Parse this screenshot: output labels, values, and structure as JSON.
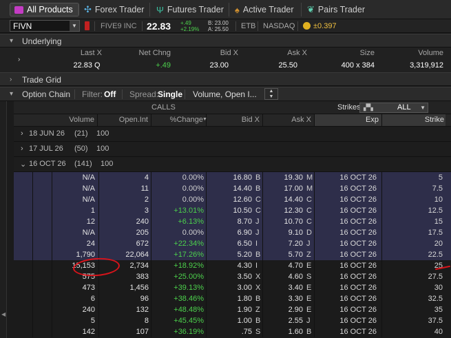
{
  "tabs": [
    {
      "label": "All Products",
      "icon": "all-products-icon",
      "active": true
    },
    {
      "label": "Forex Trader",
      "icon": "forex-icon",
      "active": false
    },
    {
      "label": "Futures Trader",
      "icon": "futures-icon",
      "active": false
    },
    {
      "label": "Active Trader",
      "icon": "active-trader-icon",
      "active": false
    },
    {
      "label": "Pairs Trader",
      "icon": "pairs-icon",
      "active": false
    }
  ],
  "quote": {
    "symbol": "FIVN",
    "name": "FIVE9 INC",
    "last": "22.83",
    "chg": "+.49",
    "pct": "+2.19%",
    "bid": "B: 23.00",
    "ask": "A: 25.50",
    "etb": "ETB",
    "exchange": "NASDAQ",
    "pl": "±0.397"
  },
  "underlying": {
    "title": "Underlying",
    "headers": [
      "Last X",
      "Net Chng",
      "Bid X",
      "Ask X",
      "Size",
      "Volume"
    ],
    "values": {
      "last": "22.83",
      "last_x": "Q",
      "net": "+.49",
      "bid": "23.00",
      "ask": "25.50",
      "size": "400 x 384",
      "volume": "3,319,912"
    }
  },
  "trade_grid": {
    "title": "Trade Grid"
  },
  "option_chain": {
    "title": "Option Chain",
    "filter_label": "Filter:",
    "filter_value": "Off",
    "spread_label": "Spread:",
    "spread_value": "Single",
    "layout_value": "Volume, Open I...",
    "calls_label": "CALLS",
    "strikes_label": "Strikes:",
    "strikes_value": "ALL",
    "columns": [
      "Volume",
      "Open.Int",
      "%Change",
      "Bid X",
      "Ask X",
      "Exp",
      "Strike"
    ],
    "groups": [
      {
        "date": "18 JUN 26",
        "days": "(21)",
        "mult": "100",
        "open": false
      },
      {
        "date": "17 JUL 26",
        "days": "(50)",
        "mult": "100",
        "open": false
      },
      {
        "date": "16 OCT 26",
        "days": "(141)",
        "mult": "100",
        "open": true
      }
    ],
    "rows": [
      {
        "vol": "N/A",
        "oi": "4",
        "pct": "0.00%",
        "bid": "16.80",
        "bx": "B",
        "ask": "19.30",
        "ax": "M",
        "exp": "16 OCT 26",
        "strike": "5",
        "itm": true
      },
      {
        "vol": "N/A",
        "oi": "11",
        "pct": "0.00%",
        "bid": "14.40",
        "bx": "B",
        "ask": "17.00",
        "ax": "M",
        "exp": "16 OCT 26",
        "strike": "7.5",
        "itm": true
      },
      {
        "vol": "N/A",
        "oi": "2",
        "pct": "0.00%",
        "bid": "12.60",
        "bx": "C",
        "ask": "14.40",
        "ax": "C",
        "exp": "16 OCT 26",
        "strike": "10",
        "itm": true
      },
      {
        "vol": "1",
        "oi": "3",
        "pct": "+13.01%",
        "bid": "10.50",
        "bx": "C",
        "ask": "12.30",
        "ax": "C",
        "exp": "16 OCT 26",
        "strike": "12.5",
        "itm": true
      },
      {
        "vol": "12",
        "oi": "240",
        "pct": "+6.13%",
        "bid": "8.70",
        "bx": "J",
        "ask": "10.70",
        "ax": "C",
        "exp": "16 OCT 26",
        "strike": "15",
        "itm": true
      },
      {
        "vol": "N/A",
        "oi": "205",
        "pct": "0.00%",
        "bid": "6.90",
        "bx": "J",
        "ask": "9.10",
        "ax": "D",
        "exp": "16 OCT 26",
        "strike": "17.5",
        "itm": true
      },
      {
        "vol": "24",
        "oi": "672",
        "pct": "+22.34%",
        "bid": "6.50",
        "bx": "I",
        "ask": "7.20",
        "ax": "J",
        "exp": "16 OCT 26",
        "strike": "20",
        "itm": true
      },
      {
        "vol": "1,790",
        "oi": "22,064",
        "pct": "+17.26%",
        "bid": "5.20",
        "bx": "B",
        "ask": "5.70",
        "ax": "Z",
        "exp": "16 OCT 26",
        "strike": "22.5",
        "itm": true
      },
      {
        "vol": "15,153",
        "oi": "2,734",
        "pct": "+18.92%",
        "bid": "4.30",
        "bx": "I",
        "ask": "4.70",
        "ax": "E",
        "exp": "16 OCT 26",
        "strike": "25",
        "itm": false
      },
      {
        "vol": "575",
        "oi": "383",
        "pct": "+25.00%",
        "bid": "3.50",
        "bx": "X",
        "ask": "4.60",
        "ax": "S",
        "exp": "16 OCT 26",
        "strike": "27.5",
        "itm": false
      },
      {
        "vol": "473",
        "oi": "1,456",
        "pct": "+39.13%",
        "bid": "3.00",
        "bx": "X",
        "ask": "3.40",
        "ax": "E",
        "exp": "16 OCT 26",
        "strike": "30",
        "itm": false
      },
      {
        "vol": "6",
        "oi": "96",
        "pct": "+38.46%",
        "bid": "1.80",
        "bx": "B",
        "ask": "3.30",
        "ax": "E",
        "exp": "16 OCT 26",
        "strike": "32.5",
        "itm": false
      },
      {
        "vol": "240",
        "oi": "132",
        "pct": "+48.48%",
        "bid": "1.90",
        "bx": "Z",
        "ask": "2.90",
        "ax": "E",
        "exp": "16 OCT 26",
        "strike": "35",
        "itm": false
      },
      {
        "vol": "5",
        "oi": "8",
        "pct": "+45.45%",
        "bid": "1.00",
        "bx": "B",
        "ask": "2.55",
        "ax": "J",
        "exp": "16 OCT 26",
        "strike": "37.5",
        "itm": false
      },
      {
        "vol": "142",
        "oi": "107",
        "pct": "+36.19%",
        "bid": ".75",
        "bx": "S",
        "ask": "1.60",
        "ax": "B",
        "exp": "16 OCT 26",
        "strike": "40",
        "itm": false
      }
    ]
  },
  "colors": {
    "positive": "#4cd14c",
    "itm_row": "#2e2e4a",
    "annotation": "#d8141b",
    "accent": "#f0c040"
  }
}
